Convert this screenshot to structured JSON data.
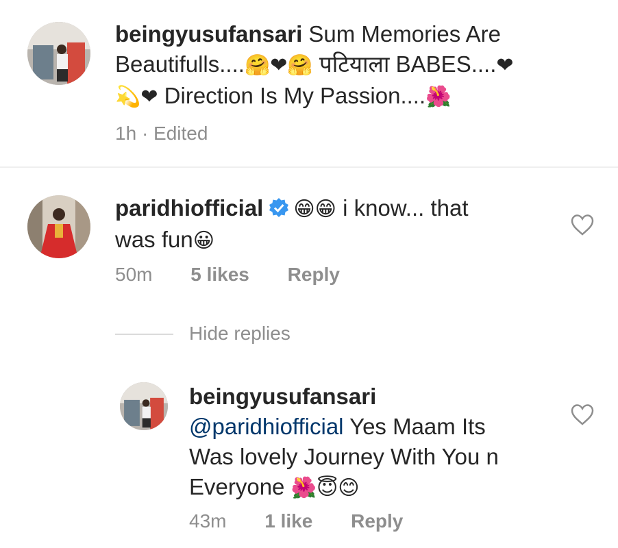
{
  "comments": [
    {
      "username": "beingyusufansari",
      "text_1": " Sum Memories Are",
      "text_2": "Beautifulls....",
      "emoji_2a": "🤗❤🤗",
      "text_2b": " पटियाला BABES....",
      "emoji_2c": "❤",
      "emoji_3a": "💫❤",
      "text_3": " Direction Is My Passion....",
      "emoji_3b": "🌺",
      "time": "1h",
      "edited": "· Edited"
    },
    {
      "username": "paridhiofficial",
      "emoji_1": "😁😁",
      "text_1": " i know... that",
      "text_2": "was fun",
      "emoji_2": "😀",
      "time": "50m",
      "likes": "5 likes",
      "reply": "Reply"
    }
  ],
  "hide_replies": "Hide replies",
  "reply": {
    "username": "beingyusufansari",
    "mention": "@paridhiofficial",
    "text_1": " Yes Maam Its",
    "text_2": "Was lovely Journey With You n",
    "text_3": "Everyone ",
    "emoji_3": "🌺😇😊",
    "time": "43m",
    "likes": "1 like",
    "reply_label": "Reply"
  },
  "colors": {
    "text": "#262626",
    "meta": "#8e8e8e",
    "mention": "#00376b",
    "verified": "#3897f0",
    "divider": "#efefef"
  },
  "icons": [
    "heart-outline-icon",
    "verified-badge-icon"
  ]
}
